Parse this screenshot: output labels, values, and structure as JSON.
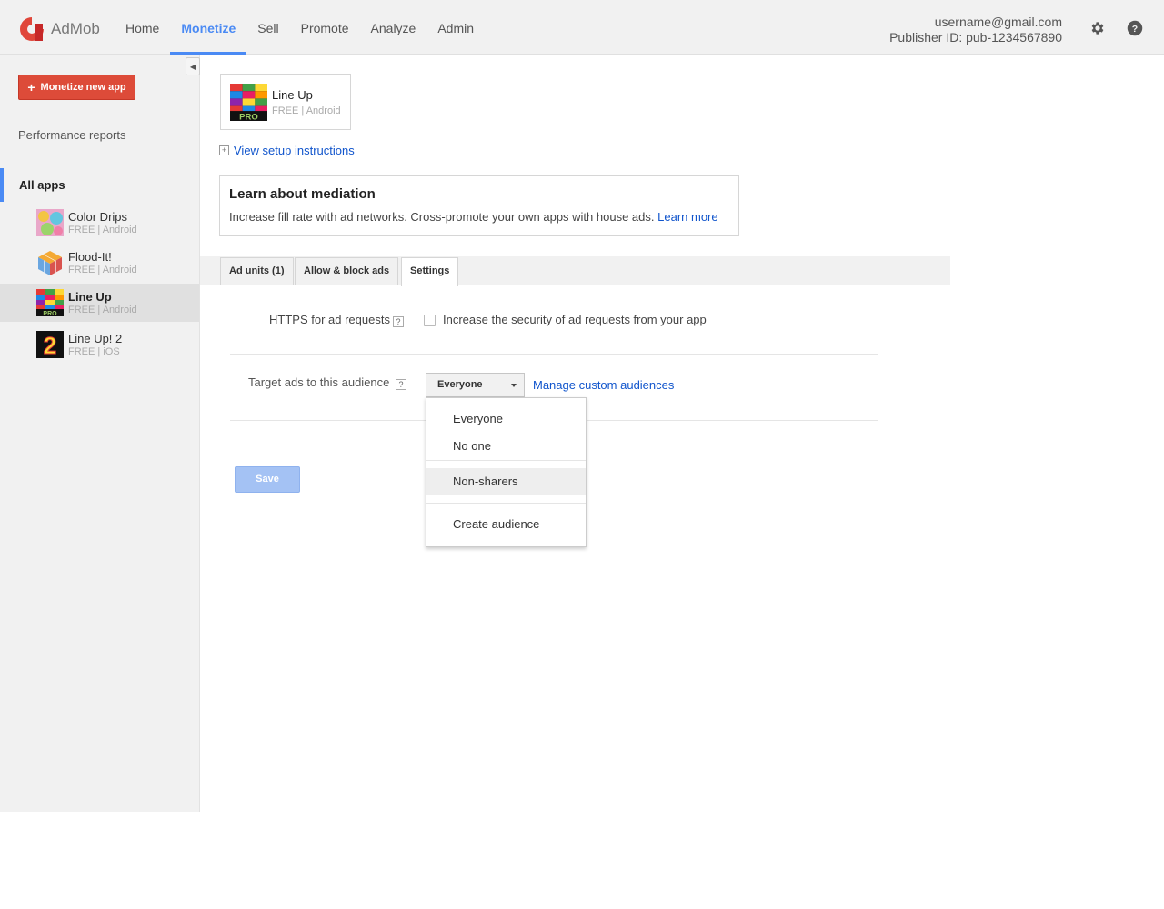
{
  "header": {
    "logo_text": "AdMob",
    "nav": [
      "Home",
      "Monetize",
      "Sell",
      "Promote",
      "Analyze",
      "Admin"
    ],
    "active_nav": "Monetize",
    "email": "username@gmail.com",
    "publisher_id": "Publisher ID: pub-1234567890",
    "icons": [
      "gear-icon",
      "help-icon"
    ]
  },
  "sidebar": {
    "monetize_button": "Monetize new app",
    "performance_reports": "Performance reports",
    "all_apps": "All apps",
    "apps": [
      {
        "name": "Color Drips",
        "free": "FREE",
        "platform": "Android"
      },
      {
        "name": "Flood-It!",
        "free": "FREE",
        "platform": "Android"
      },
      {
        "name": "Line Up",
        "free": "FREE",
        "platform": "Android",
        "selected": true
      },
      {
        "name": "Line Up! 2",
        "free": "FREE",
        "platform": "iOS"
      }
    ]
  },
  "main": {
    "app": {
      "name": "Line Up",
      "free": "FREE",
      "platform": "Android"
    },
    "setup_link": "View setup instructions",
    "mediation": {
      "title": "Learn about mediation",
      "text": "Increase fill rate with ad networks. Cross-promote your own apps with house ads.",
      "link": "Learn more"
    },
    "tabs": [
      "Ad units (1)",
      "Allow & block ads",
      "Settings"
    ],
    "active_tab": "Settings",
    "https_label": "HTTPS for ad requests",
    "https_checkbox_label": "Increase the security of ad requests from your app",
    "https_checked": false,
    "target_label": "Target ads to this audience",
    "target_value": "Everyone",
    "manage_link": "Manage custom audiences",
    "save_label": "Save",
    "help_mark": "?"
  },
  "audience_menu": {
    "options": [
      "Everyone",
      "No one",
      "Non-sharers",
      "Create audience"
    ],
    "highlighted": "Non-sharers"
  },
  "colors": {
    "accent": "#4a8af4",
    "brand_red": "#dd4b39",
    "link": "#1155cc",
    "save_disabled": "#a4c2f4"
  }
}
